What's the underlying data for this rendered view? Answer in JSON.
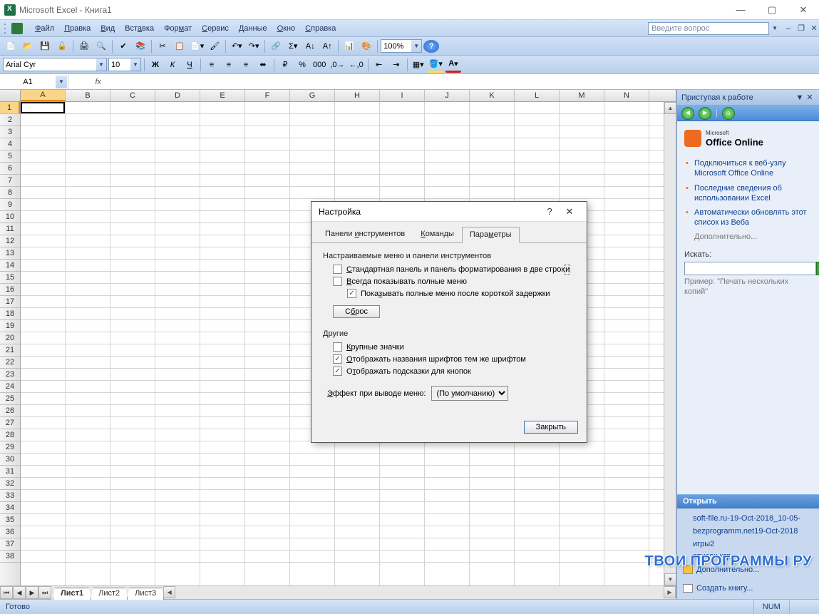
{
  "window": {
    "title": "Microsoft Excel - Книга1"
  },
  "menubar": {
    "items": [
      "Файл",
      "Правка",
      "Вид",
      "Вставка",
      "Формат",
      "Сервис",
      "Данные",
      "Окно",
      "Справка"
    ],
    "question_placeholder": "Введите вопрос"
  },
  "toolbar1": {
    "zoom": "100%"
  },
  "toolbar2": {
    "font_name": "Arial Cyr",
    "font_size": "10"
  },
  "formulabar": {
    "name_box": "A1"
  },
  "grid": {
    "columns": [
      "A",
      "B",
      "C",
      "D",
      "E",
      "F",
      "G",
      "H",
      "I",
      "J",
      "K",
      "L",
      "M",
      "N"
    ],
    "row_count": 38,
    "selected_col": "A",
    "selected_row": 1
  },
  "sheet_tabs": {
    "tabs": [
      "Лист1",
      "Лист2",
      "Лист3"
    ],
    "active": 0
  },
  "taskpane": {
    "title": "Приступая к работе",
    "office_small": "Microsoft",
    "office_big": "Office Online",
    "links": [
      "Подключиться к веб-узлу Microsoft Office Online",
      "Последние сведения об использовании Excel",
      "Автоматически обновлять этот список из Веба"
    ],
    "more": "Дополнительно...",
    "search_label": "Искать:",
    "example": "Пример:  \"Печать нескольких копий\"",
    "open_header": "Открыть",
    "files": [
      "soft-file.ru-19-Oct-2018_10-05-",
      "bezprogramm.net19-Oct-2018",
      "игры2",
      "список игр"
    ],
    "more_files": "Дополнительно...",
    "create": "Создать книгу..."
  },
  "statusbar": {
    "ready": "Готово",
    "num": "NUM"
  },
  "dialog": {
    "title": "Настройка",
    "tabs": [
      "Панели инструментов",
      "Команды",
      "Параметры"
    ],
    "active_tab": 2,
    "group1": "Настраиваемые меню и панели инструментов",
    "cb1": "Стандартная панель и панель форматирования в две строки",
    "cb2": "Всегда показывать полные меню",
    "cb3": "Показывать полные меню после короткой задержки",
    "reset": "Сброс",
    "group2": "Другие",
    "cb4": "Крупные значки",
    "cb5": "Отображать названия шрифтов тем же шрифтом",
    "cb6": "Отображать подсказки для кнопок",
    "effect_label": "Эффект при выводе меню:",
    "effect_value": "(По умолчанию)",
    "close": "Закрыть"
  },
  "watermark": "ТВОИ ПРОГРАММЫ РУ"
}
